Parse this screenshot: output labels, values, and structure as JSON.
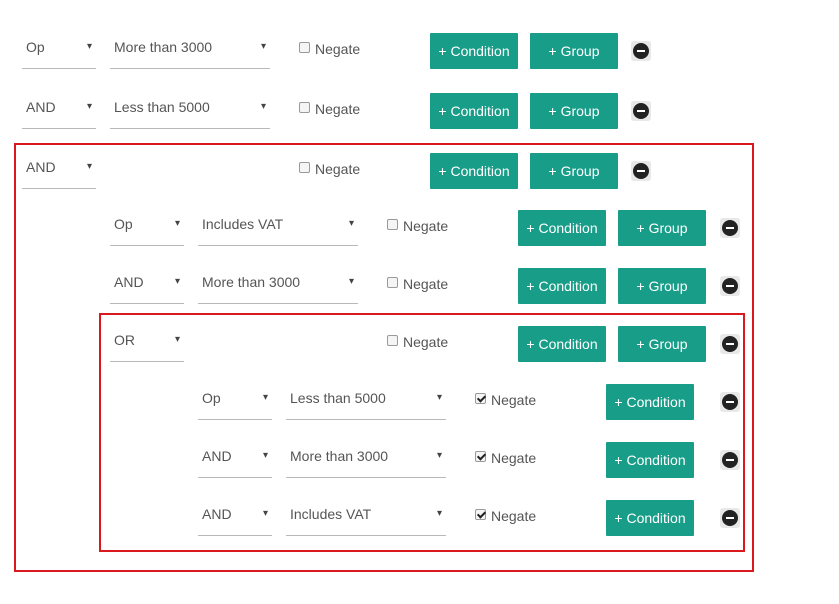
{
  "colors": {
    "accent": "#189d88",
    "group_border": "#d9191c"
  },
  "icons": {
    "arrow": "dropdown-arrow",
    "remove": "remove-circle-icon"
  },
  "labels": {
    "arrow": "▾",
    "negate": "Negate",
    "add_condition": "+ Condition",
    "add_group": "+ Group"
  },
  "rows": [
    {
      "op": "Op",
      "value": "More than 3000",
      "negate": false
    },
    {
      "op": "AND",
      "value": "Less than 5000",
      "negate": false
    },
    {
      "op": "AND",
      "negate": false
    },
    {
      "op": "Op",
      "value": "Includes VAT",
      "negate": false
    },
    {
      "op": "AND",
      "value": "More than 3000",
      "negate": false
    },
    {
      "op": "OR",
      "negate": false
    },
    {
      "op": "Op",
      "value": "Less than 5000",
      "negate": true
    },
    {
      "op": "AND",
      "value": "More than 3000",
      "negate": true
    },
    {
      "op": "AND",
      "value": "Includes VAT",
      "negate": true
    }
  ]
}
